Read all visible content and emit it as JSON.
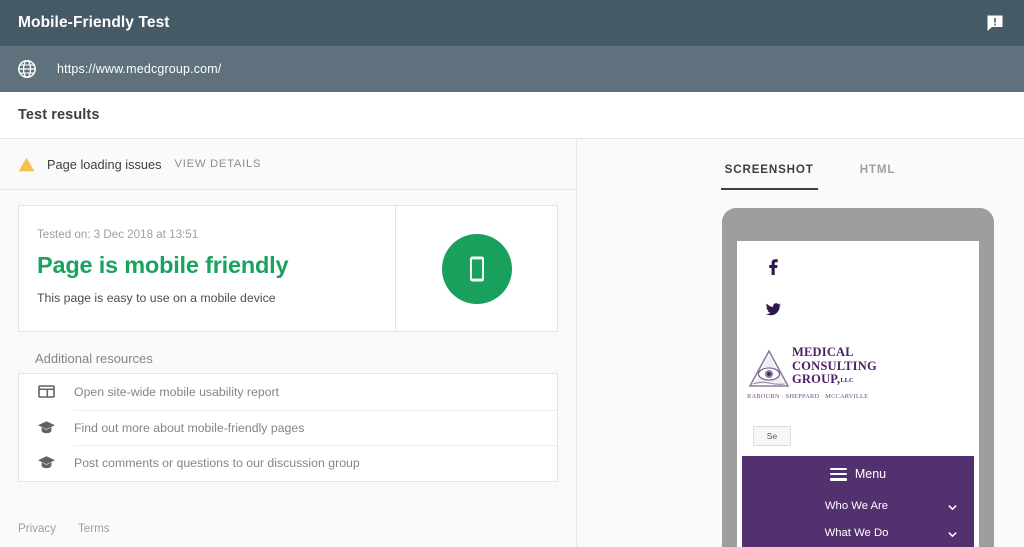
{
  "header": {
    "title": "Mobile-Friendly Test",
    "feedback_icon": "feedback-icon",
    "bg_color": "#455a64"
  },
  "urlbar": {
    "globe_icon": "globe-icon",
    "url": "https://www.medcgroup.com/",
    "bg_color": "#5e717d"
  },
  "results": {
    "title": "Test results"
  },
  "issue": {
    "warning_icon": "warning-triangle-icon",
    "label": "Page loading issues",
    "view_details": "VIEW DETAILS",
    "warning_color": "#f5c14f"
  },
  "result_card": {
    "tested_on": "Tested on: 3 Dec 2018 at 13:51",
    "verdict": "Page is mobile friendly",
    "verdict_sub": "This page is easy to use on a mobile device",
    "badge_icon": "mobile-phone-icon",
    "badge_color": "#19a05d",
    "verdict_color": "#1aa260"
  },
  "resources": {
    "heading": "Additional resources",
    "items": [
      {
        "icon": "dashboard-report-icon",
        "label": "Open site-wide mobile usability report"
      },
      {
        "icon": "graduation-cap-icon",
        "label": "Find out more about mobile-friendly pages"
      },
      {
        "icon": "graduation-cap-icon",
        "label": "Post comments or questions to our discussion group"
      }
    ]
  },
  "footer": {
    "privacy": "Privacy",
    "terms": "Terms"
  },
  "preview": {
    "tabs": [
      {
        "label": "SCREENSHOT",
        "active": true
      },
      {
        "label": "HTML",
        "active": false
      }
    ],
    "phone": {
      "frame_color": "#9e9e9e",
      "site": {
        "facebook_icon": "facebook-icon",
        "twitter_icon": "twitter-icon",
        "logo": {
          "mark": "pyramid-eye-logo-icon",
          "line1": "MEDICAL",
          "line2": "CONSULTING",
          "line3": "GROUP,",
          "suffix": "LLC",
          "subtitle": "RABOURN · SHEPPARD · MCCARVILLE",
          "color": "#4d2168"
        },
        "search_value": "Se",
        "menu": {
          "burger_icon": "hamburger-menu-icon",
          "label": "Menu",
          "bg_color": "#53316f",
          "items": [
            {
              "label": "Who We Are",
              "chevron": "chevron-down-icon"
            },
            {
              "label": "What We Do",
              "chevron": "chevron-down-icon"
            }
          ]
        }
      }
    }
  }
}
